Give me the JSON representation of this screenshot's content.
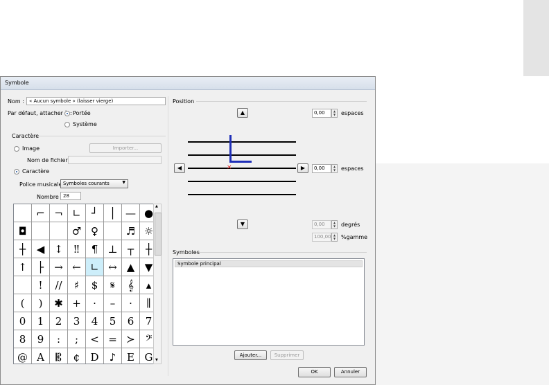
{
  "dialog": {
    "title": "Symbole"
  },
  "left": {
    "name_label": "Nom :",
    "name_value": "« Aucun symbole » (laisser vierge)",
    "attach_label": "Par défaut, attacher à :",
    "attach_options": [
      "Portée",
      "Système"
    ],
    "character_group": "Caractère",
    "image_label": "Image",
    "import_button": "Importer...",
    "filename_label": "Nom de fichier :",
    "filename_value": "",
    "character_label": "Caractère",
    "font_label": "Police musicale :",
    "font_value": "Symboles courants",
    "number_label": "Nombre :",
    "number_value": "28"
  },
  "grid": {
    "rows": [
      [
        "",
        "⌐",
        "¬",
        "∟",
        "┘",
        "│",
        "—",
        "●"
      ],
      [
        "◘",
        "",
        "",
        "♂",
        "♀",
        "",
        "♬",
        "☼"
      ],
      [
        "┼",
        "◀",
        "↕",
        "‼",
        "¶",
        "⊥",
        "┬",
        "┼"
      ],
      [
        "↑",
        "├",
        "→",
        "←",
        "∟",
        "↔",
        "▲",
        "▼"
      ],
      [
        "",
        "!",
        "//",
        "♯",
        "$",
        "𝄋",
        "𝄞",
        "▴"
      ],
      [
        "(",
        ")",
        "✱",
        "+",
        "·",
        "–",
        "·",
        "∥"
      ],
      [
        "0",
        "1",
        "2",
        "3",
        "4",
        "5",
        "6",
        "7"
      ],
      [
        "8",
        "9",
        ":",
        ";",
        "<",
        "=",
        "≻",
        "𝄢"
      ],
      [
        "@",
        "A",
        "𝄡",
        "¢",
        "D",
        "♪",
        "E",
        "G"
      ]
    ],
    "selected": "3-4"
  },
  "position": {
    "group": "Position",
    "top_value": "0,00",
    "top_unit": "espaces",
    "mid_value": "0,00",
    "mid_unit": "espaces",
    "deg_value": "0,00",
    "deg_unit": "degrés",
    "scale_value": "100,00",
    "scale_unit": "%gamme",
    "up_icon": "▲",
    "down_icon": "▼",
    "left_icon": "◀",
    "right_icon": "▶",
    "symbol_color": "#1f2fb8",
    "origin_color": "#e02020",
    "origin_mark": "×"
  },
  "symbols": {
    "group": "Symboles",
    "items": [
      "Symbole principal"
    ],
    "add_button": "Ajouter...",
    "delete_button": "Supprimer"
  },
  "footer": {
    "ok": "OK",
    "cancel": "Annuler"
  }
}
